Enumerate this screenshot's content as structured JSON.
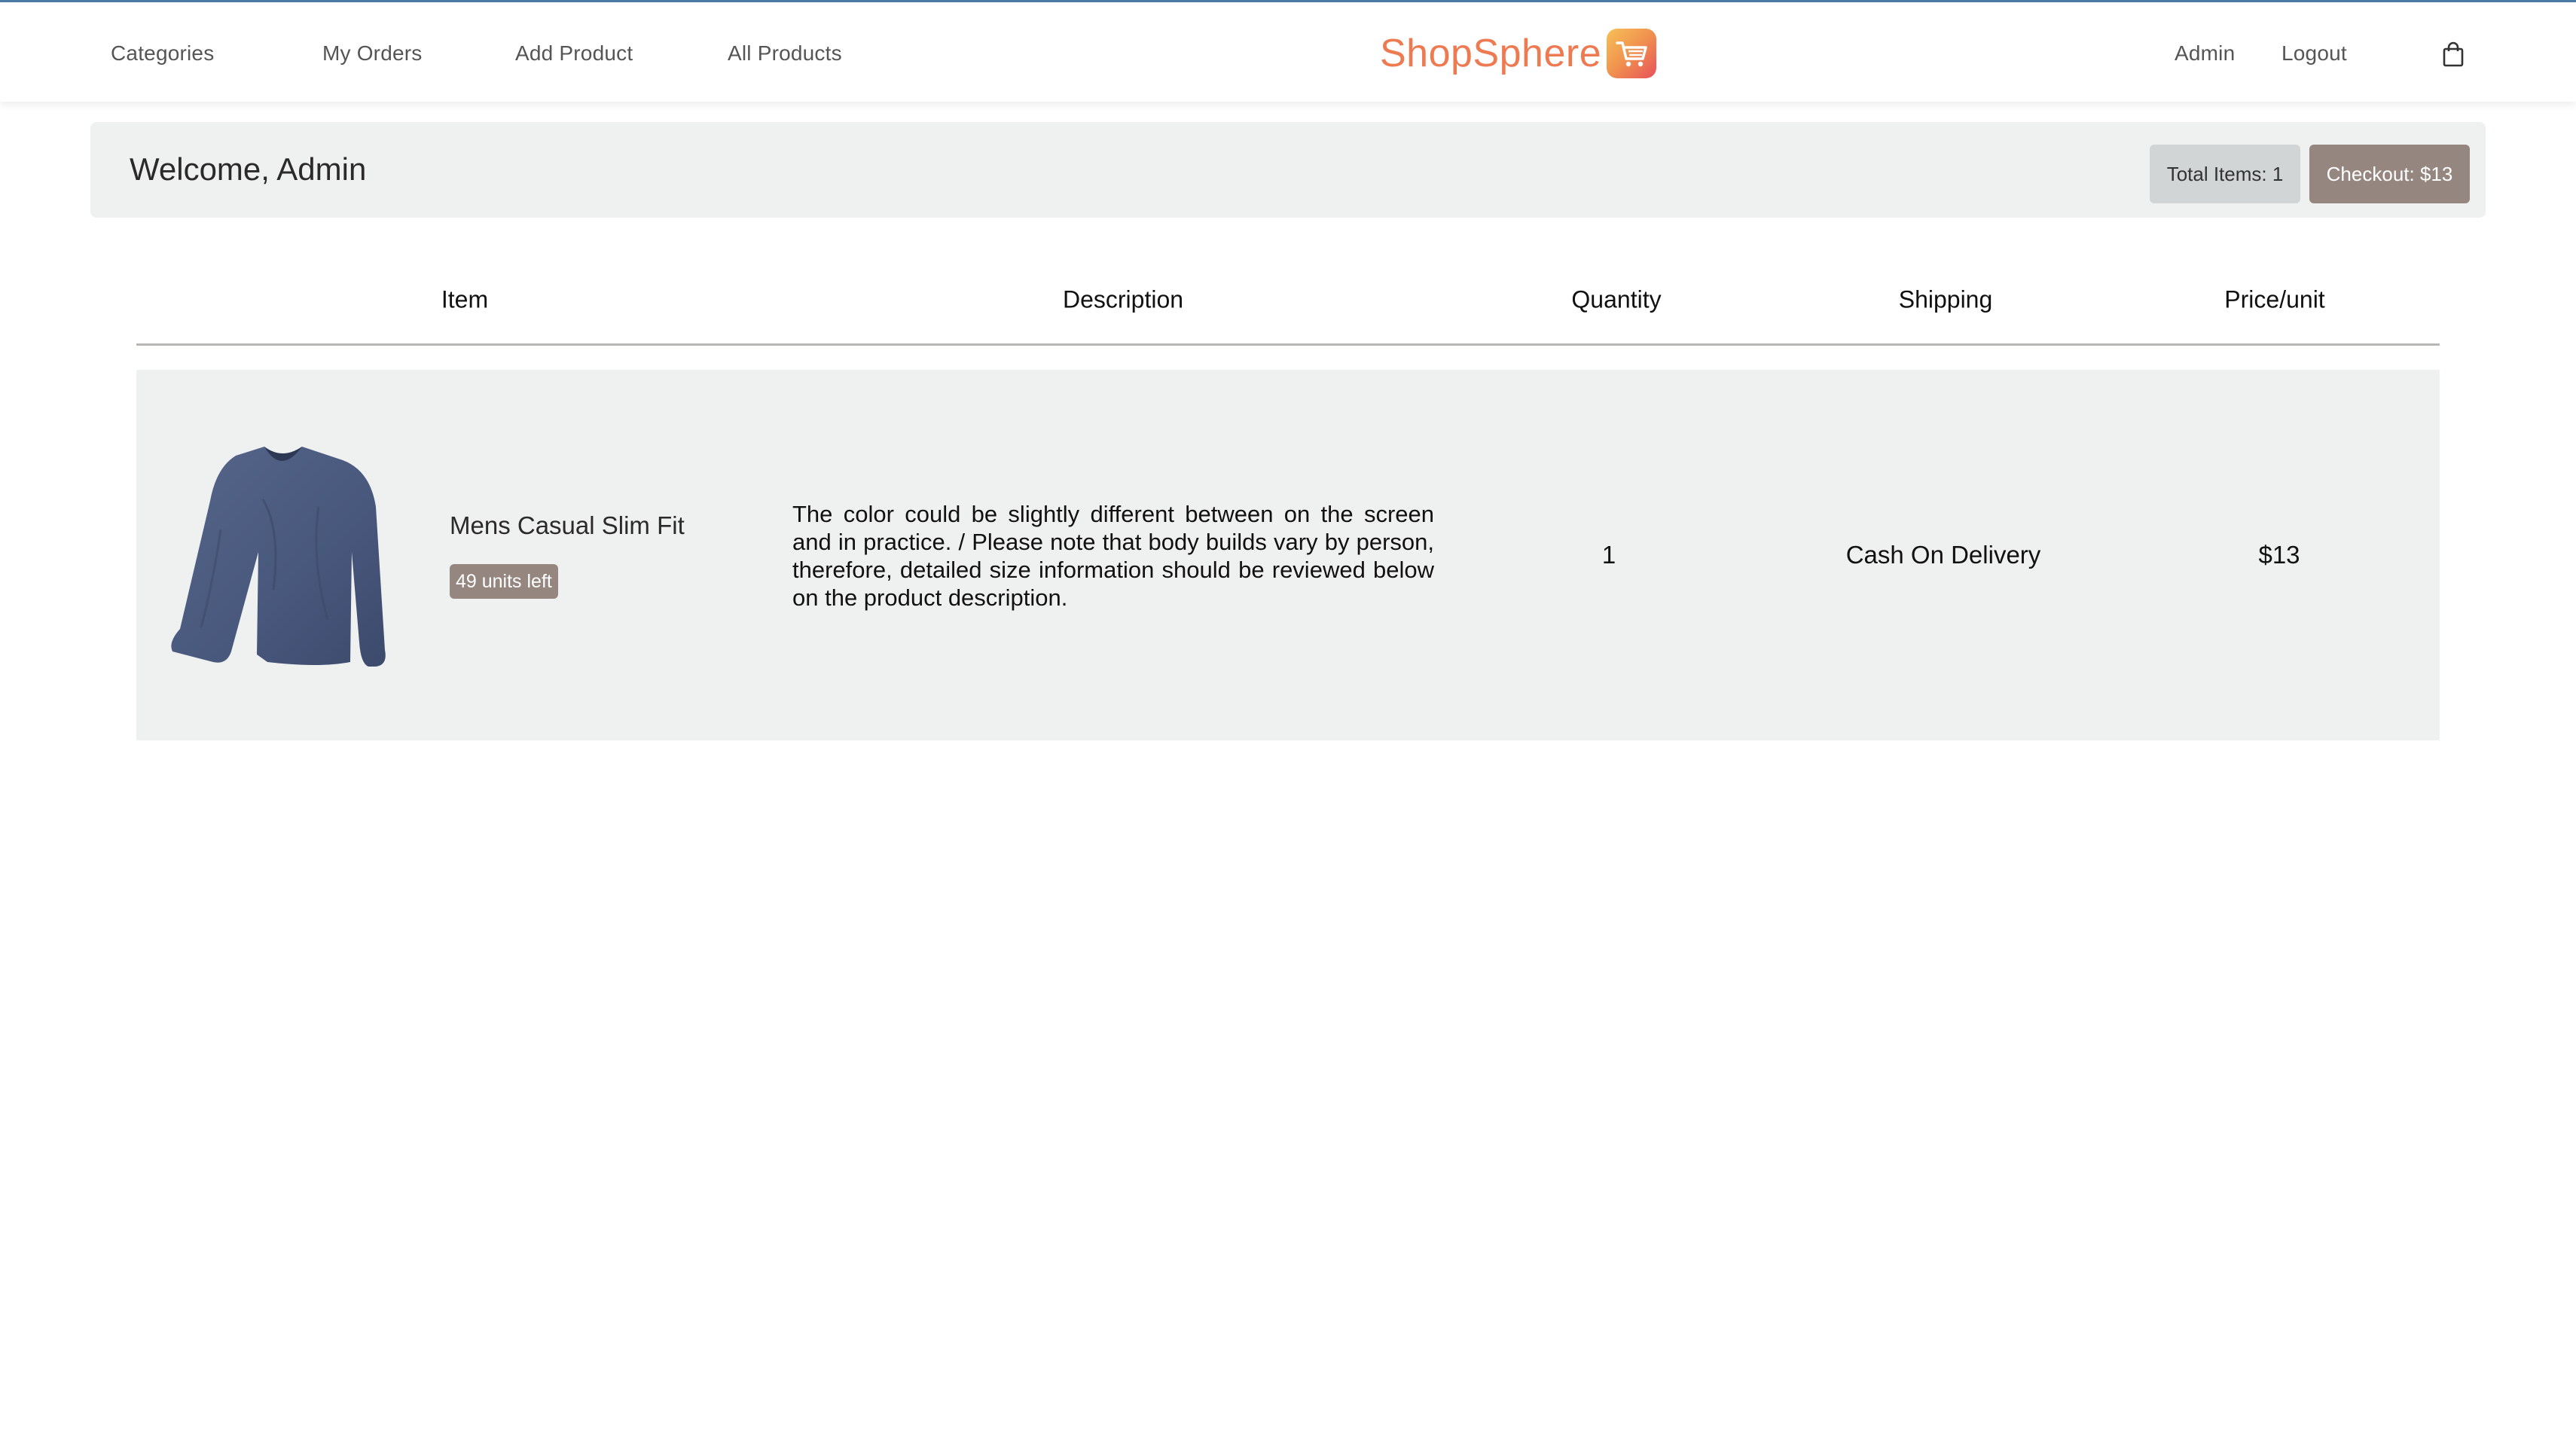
{
  "nav": {
    "left_links": [
      "Categories",
      "My Orders",
      "Add Product",
      "All Products"
    ],
    "brand": "ShopSphere",
    "right_links": [
      "Admin",
      "Logout"
    ],
    "logo_icon": "shopping-cart-icon",
    "bag_icon": "shopping-bag-icon"
  },
  "welcome": {
    "text": "Welcome, Admin",
    "total_items_label": "Total Items: 1",
    "checkout_label": "Checkout: $13"
  },
  "table": {
    "headers": [
      "Item",
      "Description",
      "Quantity",
      "Shipping",
      "Price/unit"
    ],
    "rows": [
      {
        "name": "Mens Casual Slim Fit",
        "stock": "49 units left",
        "description": "The color could be slightly different between on the screen and in practice. / Please note that body builds vary by person, therefore, detailed size information should be reviewed below on the product description.",
        "quantity": "1",
        "shipping": "Cash On Delivery",
        "price": "$13"
      }
    ]
  },
  "colors": {
    "brand": "#ee7a52",
    "checkout_button": "#968680",
    "total_button": "#d2d5d6",
    "panel_bg": "#eff0f0"
  }
}
